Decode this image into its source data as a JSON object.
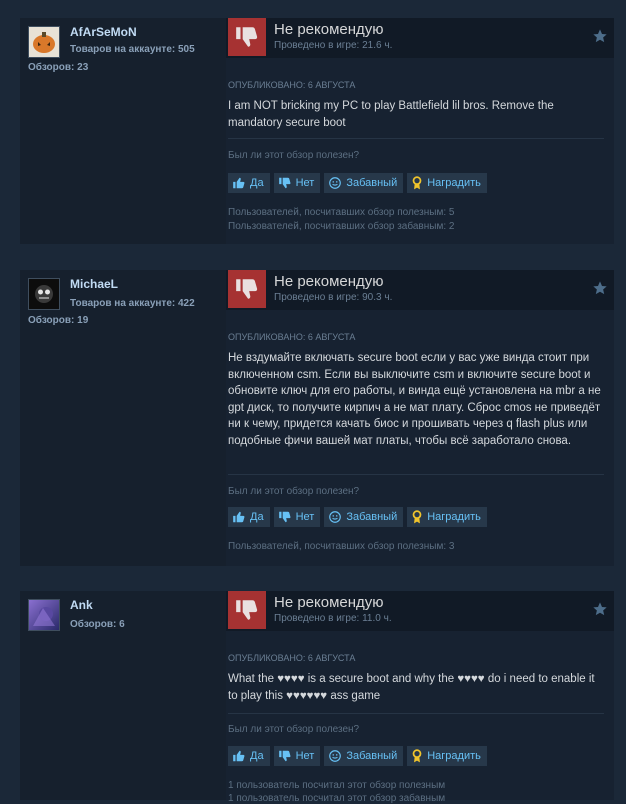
{
  "reviews": [
    {
      "author": {
        "name": "AfArSeMoN",
        "products": "Товаров на аккаунте: 505",
        "reviews": "Обзоров: 23"
      },
      "verdict": "Не рекомендую",
      "hours": "Проведено в игре: 21.6 ч.",
      "posted": "ОПУБЛИКОВАНО: 6 АВГУСТА",
      "text": "I am NOT bricking my PC to play Battlefield lil bros. Remove the mandatory secure boot",
      "helpful_question": "Был ли этот обзор полезен?",
      "buttons": {
        "yes": "Да",
        "no": "Нет",
        "funny": "Забавный",
        "award": "Наградить"
      },
      "stats": [
        "Пользователей, посчитавших обзор полезным: 5",
        "Пользователей, посчитавших обзор забавным: 2"
      ]
    },
    {
      "author": {
        "name": "MichaeL",
        "products": "Товаров на аккаунте: 422",
        "reviews": "Обзоров: 19"
      },
      "verdict": "Не рекомендую",
      "hours": "Проведено в игре: 90.3 ч.",
      "posted": "ОПУБЛИКОВАНО: 6 АВГУСТА",
      "text": "Не вздумайте включать secure boot если у вас уже винда стоит при включенном csm. Если вы выключите csm и включите secure boot и обновите ключ для его работы, и винда ещё установлена на mbr а не gpt диск, то получите кирпич а не мат плату. Сброс cmos не приведёт ни к чему, придется качать биос и прошивать через q flash plus или подобные фичи вашей мат платы, чтобы всё заработало снова.",
      "helpful_question": "Был ли этот обзор полезен?",
      "buttons": {
        "yes": "Да",
        "no": "Нет",
        "funny": "Забавный",
        "award": "Наградить"
      },
      "stats": [
        "Пользователей, посчитавших обзор полезным: 3"
      ]
    },
    {
      "author": {
        "name": "Ank",
        "reviews": "Обзоров: 6"
      },
      "verdict": "Не рекомендую",
      "hours": "Проведено в игре: 11.0 ч.",
      "posted": "ОПУБЛИКОВАНО: 6 АВГУСТА",
      "text": "What the ♥♥♥♥ is a secure boot and why the ♥♥♥♥ do i need to enable it to play this ♥♥♥♥♥♥ ass game",
      "helpful_question": "Был ли этот обзор полезен?",
      "buttons": {
        "yes": "Да",
        "no": "Нет",
        "funny": "Забавный",
        "award": "Наградить"
      },
      "stats": [
        "1 пользователь посчитал этот обзор полезным",
        "1 пользователь посчитал этот обзор забавным"
      ]
    }
  ],
  "colors": {
    "page_bg": "#1b2838",
    "thumb_down_bg": "#a63232",
    "link_blue": "#67c1f5",
    "author_name": "#c1dbf4"
  }
}
